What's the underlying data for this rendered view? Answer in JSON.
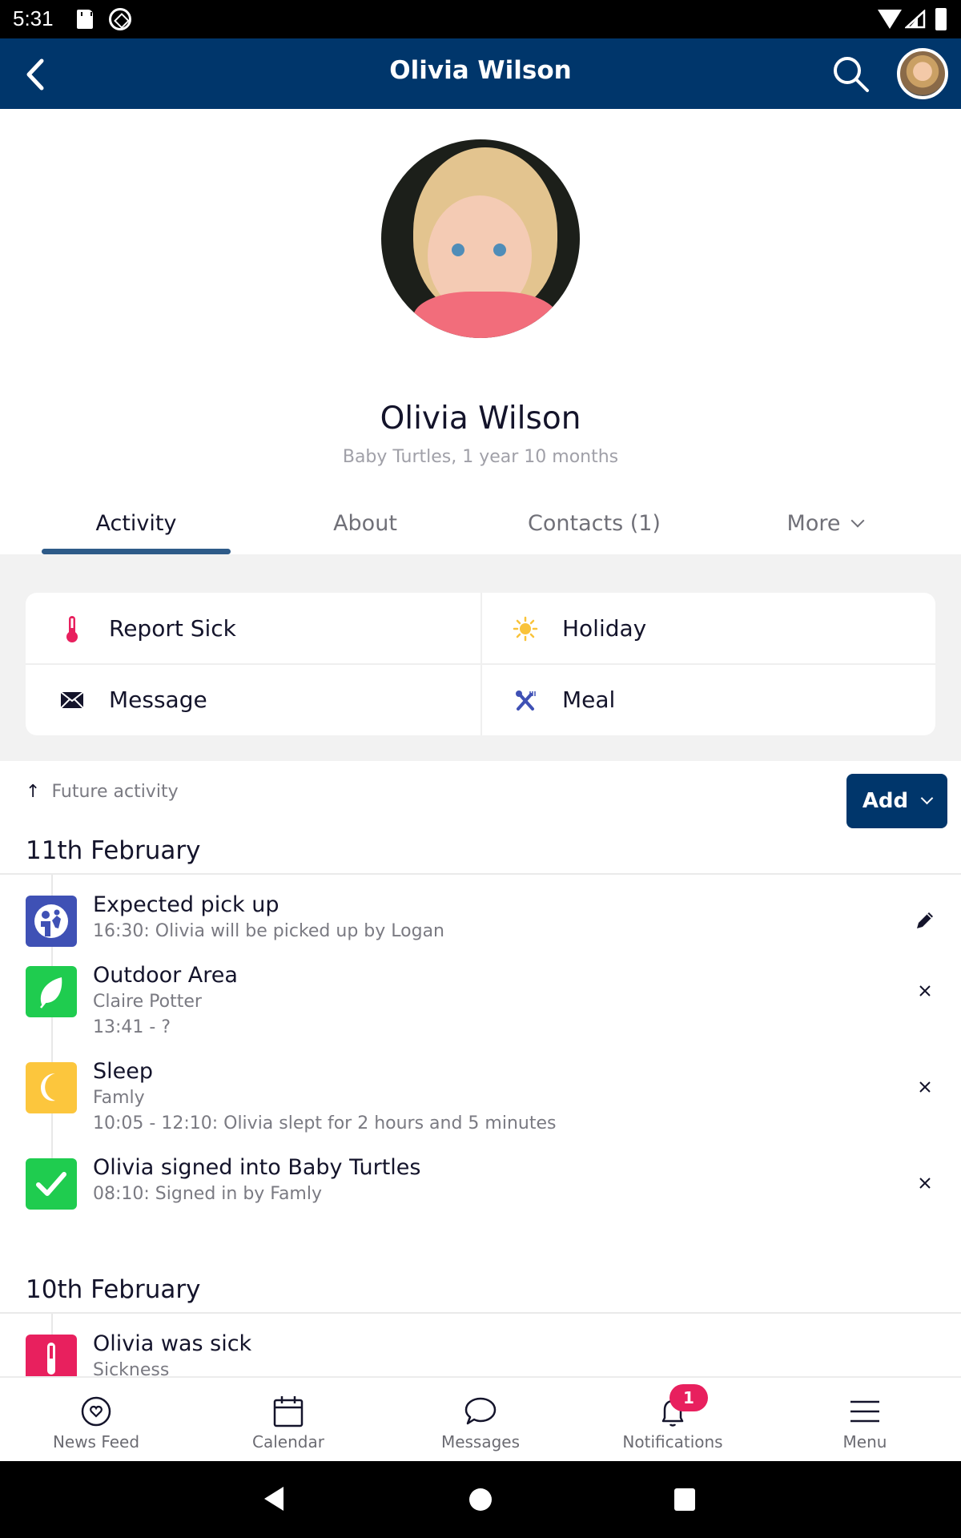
{
  "status_bar": {
    "time": "5:31"
  },
  "app_bar": {
    "title": "Olivia Wilson"
  },
  "profile": {
    "name": "Olivia Wilson",
    "subtitle": "Baby Turtles, 1 year 10 months"
  },
  "tabs": [
    {
      "label": "Activity",
      "active": true
    },
    {
      "label": "About",
      "active": false
    },
    {
      "label": "Contacts (1)",
      "active": false
    },
    {
      "label": "More",
      "active": false
    }
  ],
  "quick_actions": [
    {
      "label": "Report Sick",
      "icon": "thermometer-icon",
      "color": "#e8205e"
    },
    {
      "label": "Holiday",
      "icon": "sun-icon",
      "color": "#f9c33a"
    },
    {
      "label": "Message",
      "icon": "envelope-icon",
      "color": "#14142b"
    },
    {
      "label": "Meal",
      "icon": "utensils-icon",
      "color": "#3f51b5"
    }
  ],
  "feed": {
    "future_label": "Future activity",
    "add_button": "Add",
    "days": [
      {
        "date": "11th February",
        "entries": [
          {
            "title": "Expected pick up",
            "lines": [
              "16:30: Olivia will be picked up by Logan"
            ],
            "icon": "pickup-icon",
            "color": "#3f51b5",
            "action": "edit"
          },
          {
            "title": "Outdoor Area",
            "lines": [
              "Claire Potter",
              "13:41 - ?"
            ],
            "icon": "leaf-icon",
            "color": "#1fcc4f",
            "action": "remove"
          },
          {
            "title": "Sleep",
            "lines": [
              "Famly",
              "10:05 - 12:10: Olivia slept for 2 hours and 5 minutes"
            ],
            "icon": "moon-icon",
            "color": "#fcc63d",
            "action": "remove"
          },
          {
            "title": "Olivia signed into Baby Turtles",
            "lines": [
              "08:10: Signed in by Famly"
            ],
            "icon": "check-icon",
            "color": "#1fcc4f",
            "action": "remove"
          }
        ]
      },
      {
        "date": "10th February",
        "entries": [
          {
            "title": "Olivia was sick",
            "lines": [
              "Sickness"
            ],
            "icon": "thermometer-icon",
            "color": "#e8205e"
          }
        ]
      }
    ]
  },
  "bottom_nav": [
    {
      "label": "News Feed",
      "icon": "heart-circle-icon"
    },
    {
      "label": "Calendar",
      "icon": "calendar-icon"
    },
    {
      "label": "Messages",
      "icon": "chat-bubble-icon"
    },
    {
      "label": "Notifications",
      "icon": "bell-icon",
      "badge": "1"
    },
    {
      "label": "Menu",
      "icon": "hamburger-menu-icon"
    }
  ],
  "colors": {
    "brand": "#00366b",
    "accent_pink": "#e8205e",
    "tab_underline": "#2e5b89"
  }
}
